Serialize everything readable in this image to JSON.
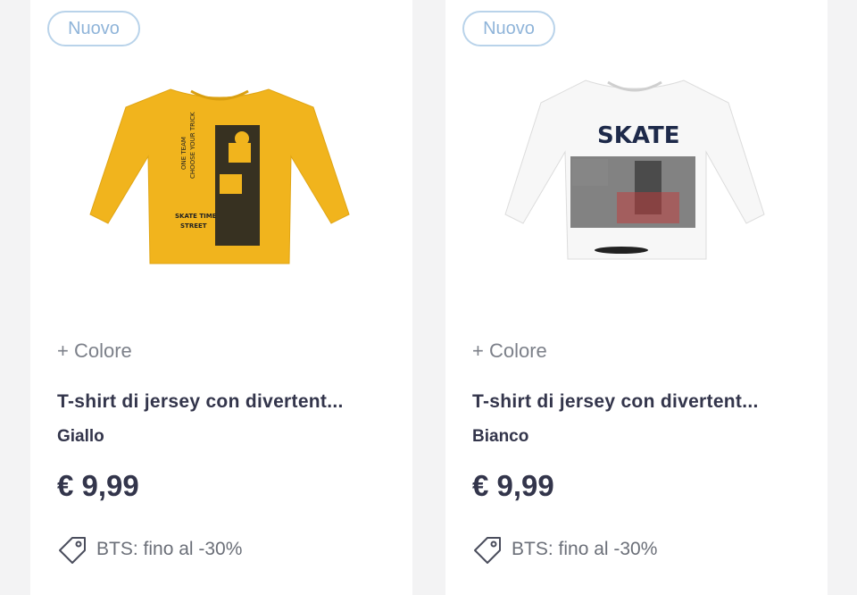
{
  "products": [
    {
      "badge": "Nuovo",
      "colors_label": "+ Colore",
      "title": "T-shirt di jersey con divertent...",
      "variant": "Giallo",
      "price": "€ 9,99",
      "promo": "BTS: fino al -30%",
      "shirt_color": "#f1b41d",
      "image_text_lines": [
        "ONE TEAM",
        "CHOOSE YOUR TRICK",
        "SKATE TIME",
        "STREET"
      ]
    },
    {
      "badge": "Nuovo",
      "colors_label": "+ Colore",
      "title": "T-shirt di jersey con divertent...",
      "variant": "Bianco",
      "price": "€ 9,99",
      "promo": "BTS: fino al -30%",
      "shirt_color": "#f7f7f7",
      "image_text": "SKATE"
    }
  ],
  "colors": {
    "badge_border": "#b9d3ea",
    "badge_text": "#8fb4d9",
    "text_dark": "#33354b",
    "text_muted": "#7c8089",
    "page_bg": "#f3f3f4"
  },
  "icons": {
    "promo": "price-tag-icon"
  }
}
